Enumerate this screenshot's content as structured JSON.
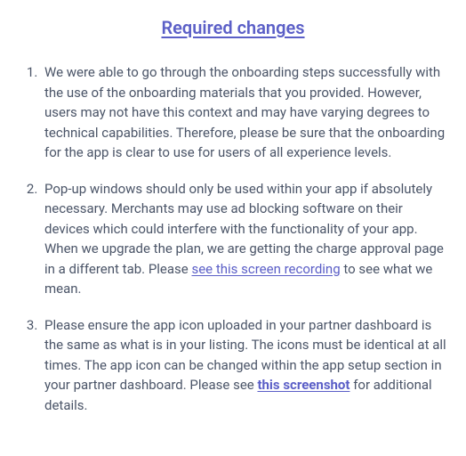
{
  "heading": "Required changes",
  "items": [
    {
      "text": "We were able to go through the onboarding steps successfully with the use of the onboarding materials that you provided. However, users may not have this context and may have varying degrees to technical capabilities. Therefore, please be sure that the onboarding for the app is clear to use for users of all experience levels."
    },
    {
      "pre": "Pop-up windows should only be used within your app if absolutely necessary. Merchants may use ad blocking software on their devices which could interfere with the functionality of your app. When we upgrade the plan, we are getting the charge approval page in a different tab. Please ",
      "link": "see this screen recording",
      "post": " to see what we mean."
    },
    {
      "pre": "Please ensure the app icon uploaded in your partner dashboard is the same as what is in your listing. The icons must be identical at all times. The app icon can be changed within the app setup section in your partner dashboard. Please see ",
      "link": "this screenshot",
      "post": " for additional details."
    }
  ]
}
